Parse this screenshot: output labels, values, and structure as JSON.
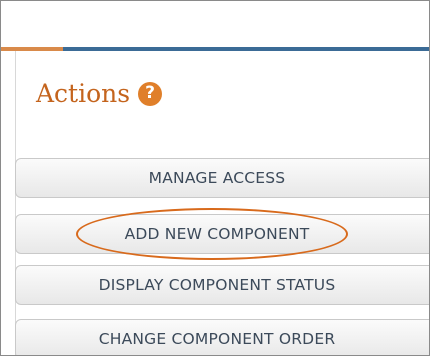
{
  "actions_panel": {
    "title": "Actions",
    "help_icon": "question-mark-circle-icon",
    "help_glyph": "?",
    "buttons": [
      {
        "label": "MANAGE ACCESS"
      },
      {
        "label": "ADD NEW COMPONENT",
        "highlighted": true
      },
      {
        "label": "DISPLAY COMPONENT STATUS"
      },
      {
        "label": "CHANGE COMPONENT ORDER"
      }
    ]
  },
  "colors": {
    "title": "#c4641d",
    "help_icon_bg": "#e07f2a",
    "header_bar": "#3b6b96",
    "header_accent": "#d98a4a",
    "highlight_ellipse": "#d86a1c",
    "button_text": "#3c4a5a"
  }
}
